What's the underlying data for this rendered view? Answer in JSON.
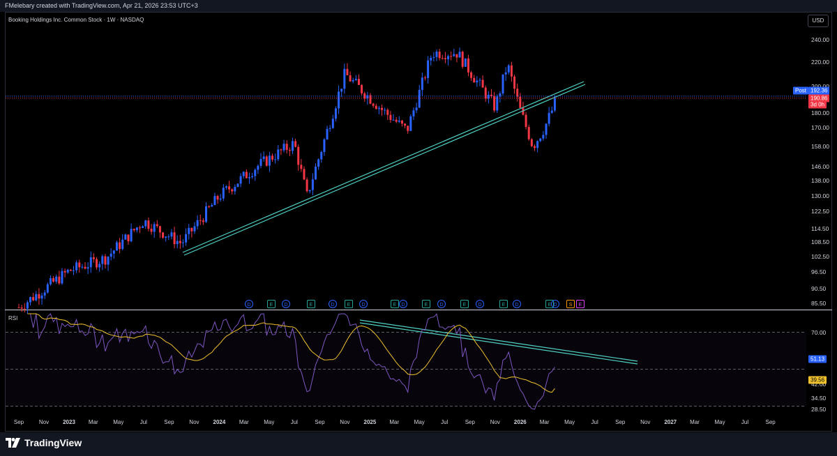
{
  "header": {
    "creator_text": "FMelebary created with TradingView.com, Apr 21, 2026 23:53 UTC+3"
  },
  "chart": {
    "symbol_title": "Booking Holdings Inc. Common Stock · 1W · NASDAQ",
    "currency_button": "USD",
    "post_label": "Post",
    "post_price": "192.36",
    "last_price": "190.86",
    "countdown": "3d 0h",
    "rsi_label": "RSI",
    "rsi_value": "51.13",
    "rsi_ma_value": "39.56"
  },
  "footer": {
    "brand": "TradingView"
  },
  "colors": {
    "up": "#2962ff",
    "down": "#f23645",
    "trendline": "#4fd1c5",
    "rsi": "#7e57c2",
    "rsi_ma": "#f0c22e",
    "last_price_line": "#f23645"
  },
  "chart_data": [
    {
      "type": "candlestick",
      "title": "Booking Holdings Inc. Common Stock · 1W · NASDAQ",
      "scale": "log",
      "y_ticks": [
        "240.00",
        "220.00",
        "200.00",
        "180.00",
        "170.00",
        "158.00",
        "146.00",
        "138.00",
        "130.00",
        "122.50",
        "114.50",
        "108.50",
        "102.50",
        "96.50",
        "90.50",
        "85.50"
      ],
      "x_ticks": [
        "Sep",
        "Nov",
        "2023",
        "Mar",
        "May",
        "Jul",
        "Sep",
        "Nov",
        "2024",
        "Mar",
        "May",
        "Jul",
        "Sep",
        "Nov",
        "2025",
        "Mar",
        "May",
        "Jul",
        "Sep",
        "Nov",
        "2026",
        "Mar",
        "May",
        "Jul",
        "Sep",
        "Nov",
        "2027",
        "Mar",
        "May",
        "Jul",
        "Sep"
      ],
      "grid": false,
      "key_points": [
        {
          "date": "2022-09",
          "close": 84
        },
        {
          "date": "2023-01",
          "close": 97
        },
        {
          "date": "2023-04",
          "close": 102
        },
        {
          "date": "2023-07",
          "close": 118
        },
        {
          "date": "2023-10",
          "close": 108
        },
        {
          "date": "2024-01",
          "close": 130
        },
        {
          "date": "2024-04",
          "close": 146
        },
        {
          "date": "2024-07",
          "close": 160
        },
        {
          "date": "2024-08",
          "close": 130
        },
        {
          "date": "2024-11",
          "close": 210
        },
        {
          "date": "2025-02",
          "close": 182
        },
        {
          "date": "2025-04",
          "close": 168
        },
        {
          "date": "2025-06",
          "close": 228
        },
        {
          "date": "2025-08",
          "close": 228
        },
        {
          "date": "2025-11",
          "close": 184
        },
        {
          "date": "2025-12",
          "close": 218
        },
        {
          "date": "2026-01",
          "close": 182
        },
        {
          "date": "2026-02",
          "close": 158
        },
        {
          "date": "2026-03",
          "close": 170
        },
        {
          "date": "2026-04",
          "close": 190.86
        }
      ],
      "event_markers": [
        "D",
        "E",
        "D",
        "E",
        "D",
        "E",
        "D",
        "E",
        "D",
        "E",
        "D",
        "E",
        "D",
        "E",
        "D",
        "E",
        "D",
        "S",
        "E"
      ]
    },
    {
      "type": "line",
      "title": "RSI",
      "y_ticks": [
        "70.00",
        "42.00",
        "34.50",
        "28.50"
      ],
      "levels": [
        70,
        50,
        30
      ],
      "series": [
        {
          "name": "RSI",
          "last": 51.13
        },
        {
          "name": "RSI MA",
          "last": 39.56
        }
      ]
    }
  ]
}
